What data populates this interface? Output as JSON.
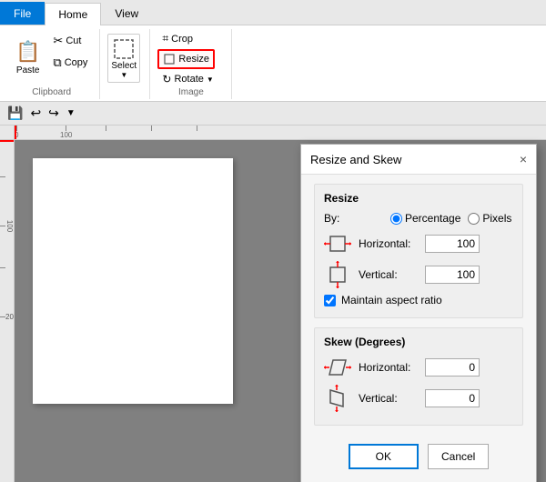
{
  "app": {
    "title": "Resize and Skew"
  },
  "tabs": [
    {
      "label": "File",
      "active": false,
      "file": true
    },
    {
      "label": "Home",
      "active": true
    },
    {
      "label": "View",
      "active": false
    }
  ],
  "clipboard_group": {
    "label": "Clipboard",
    "paste": "Paste",
    "cut": "Cut",
    "copy": "Copy"
  },
  "image_group": {
    "label": "Image",
    "crop": "Crop",
    "resize": "Resize",
    "rotate": "Rotate"
  },
  "tools_group": {
    "label": "",
    "select": "Select"
  },
  "dialog": {
    "title": "Resize and Skew",
    "close": "×",
    "resize_section": "Resize",
    "by_label": "By:",
    "percentage_label": "Percentage",
    "pixels_label": "Pixels",
    "horizontal_label": "Horizontal:",
    "vertical_label": "Vertical:",
    "horizontal_resize_value": "100",
    "vertical_resize_value": "100",
    "maintain_aspect": "Maintain aspect ratio",
    "skew_section": "Skew (Degrees)",
    "horizontal_skew_label": "Horizontal:",
    "vertical_skew_label": "Vertical:",
    "horizontal_skew_value": "0",
    "vertical_skew_value": "0",
    "ok_label": "OK",
    "cancel_label": "Cancel"
  }
}
